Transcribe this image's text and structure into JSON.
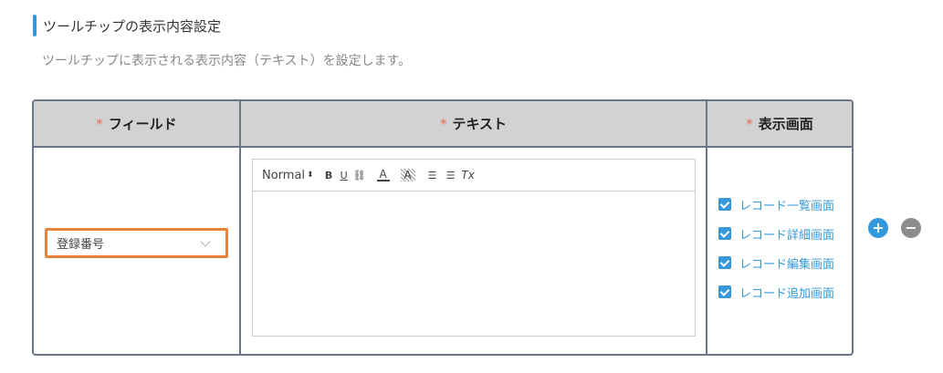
{
  "section": {
    "title": "ツールチップの表示内容設定",
    "description": "ツールチップに表示される表示内容（テキスト）を設定します。"
  },
  "table": {
    "headers": [
      {
        "required_mark": "*",
        "label": "フィールド"
      },
      {
        "required_mark": "*",
        "label": "テキスト"
      },
      {
        "required_mark": "*",
        "label": "表示画面"
      }
    ],
    "row": {
      "field_value": "登録番号",
      "editor": {
        "header_format": "Normal",
        "toolbar": {
          "bold": "B",
          "underline": "U",
          "link": "⛓",
          "color": "A",
          "background": "A",
          "ordered_list": "☰",
          "bullet_list": "☰",
          "clean": "Tx"
        },
        "content": ""
      },
      "screens": [
        {
          "label": "レコード一覧画面",
          "checked": true
        },
        {
          "label": "レコード詳細画面",
          "checked": true
        },
        {
          "label": "レコード編集画面",
          "checked": true
        },
        {
          "label": "レコード追加画面",
          "checked": true
        }
      ]
    }
  },
  "actions": {
    "add": "+",
    "remove": "−"
  },
  "colors": {
    "accent": "#3498db",
    "required": "#e86c4c",
    "focus_border": "#e8833a",
    "header_bg": "#d2d2d2",
    "border": "#6b7489"
  }
}
